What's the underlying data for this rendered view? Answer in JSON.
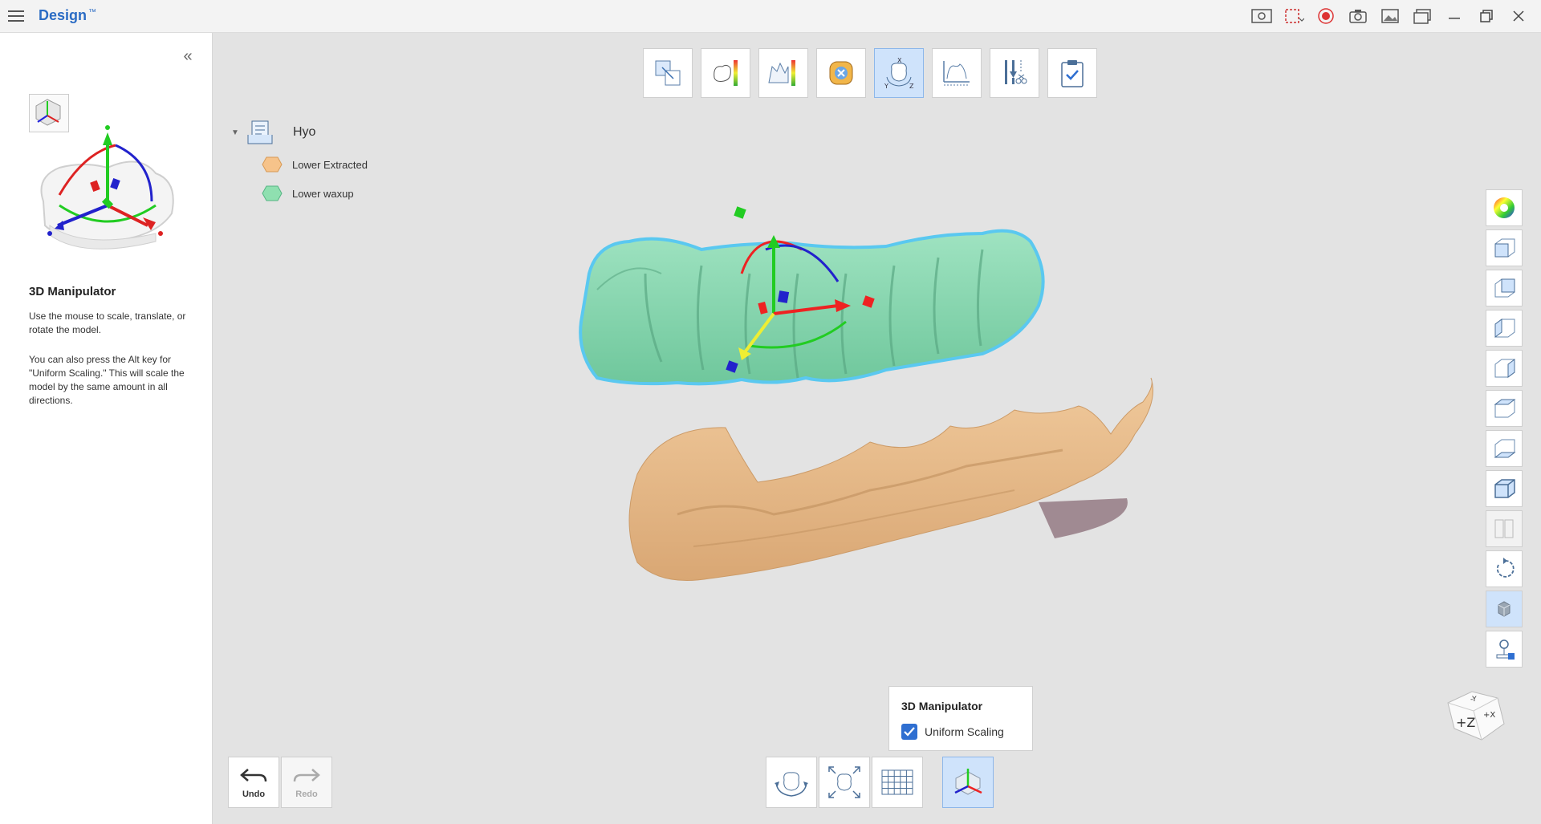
{
  "app": {
    "title": "Design",
    "badge": "™"
  },
  "left_panel": {
    "title": "3D Manipulator",
    "paragraph1": "Use the mouse to scale, translate, or rotate the model.",
    "paragraph2": "You can also press the Alt key for \"Uniform Scaling.\" This will scale the model by the same amount in all directions."
  },
  "tree": {
    "root": "Hyo",
    "items": [
      {
        "label": "Lower Extracted",
        "color": "#f6c38a"
      },
      {
        "label": "Lower waxup",
        "color": "#8fe0b0"
      }
    ]
  },
  "manipulator_popup": {
    "title": "3D Manipulator",
    "checkbox_label": "Uniform Scaling",
    "checked": true
  },
  "undo": {
    "label": "Undo"
  },
  "redo": {
    "label": "Redo"
  },
  "colors": {
    "accent": "#2b6cc4",
    "active_bg": "#cfe3fb",
    "waxup": "#8fd9b3",
    "extracted": "#e8bf8e",
    "outline": "#5ac8f0"
  },
  "icons": {
    "top_toolbar": [
      "align-icon",
      "deviation-map-icon",
      "section-deviation-icon",
      "occlusion-map-icon",
      "manipulator-xyz-icon",
      "measurement-icon",
      "tools-icon",
      "checklist-icon"
    ],
    "right_toolbar": [
      "color-wheel-icon",
      "view-front-icon",
      "view-back-icon",
      "view-left-icon",
      "view-right-icon",
      "view-top-icon",
      "view-bottom-icon",
      "view-iso-icon",
      "split-view-icon",
      "reset-rotation-icon",
      "solid-cube-icon",
      "camera-pin-icon"
    ]
  }
}
